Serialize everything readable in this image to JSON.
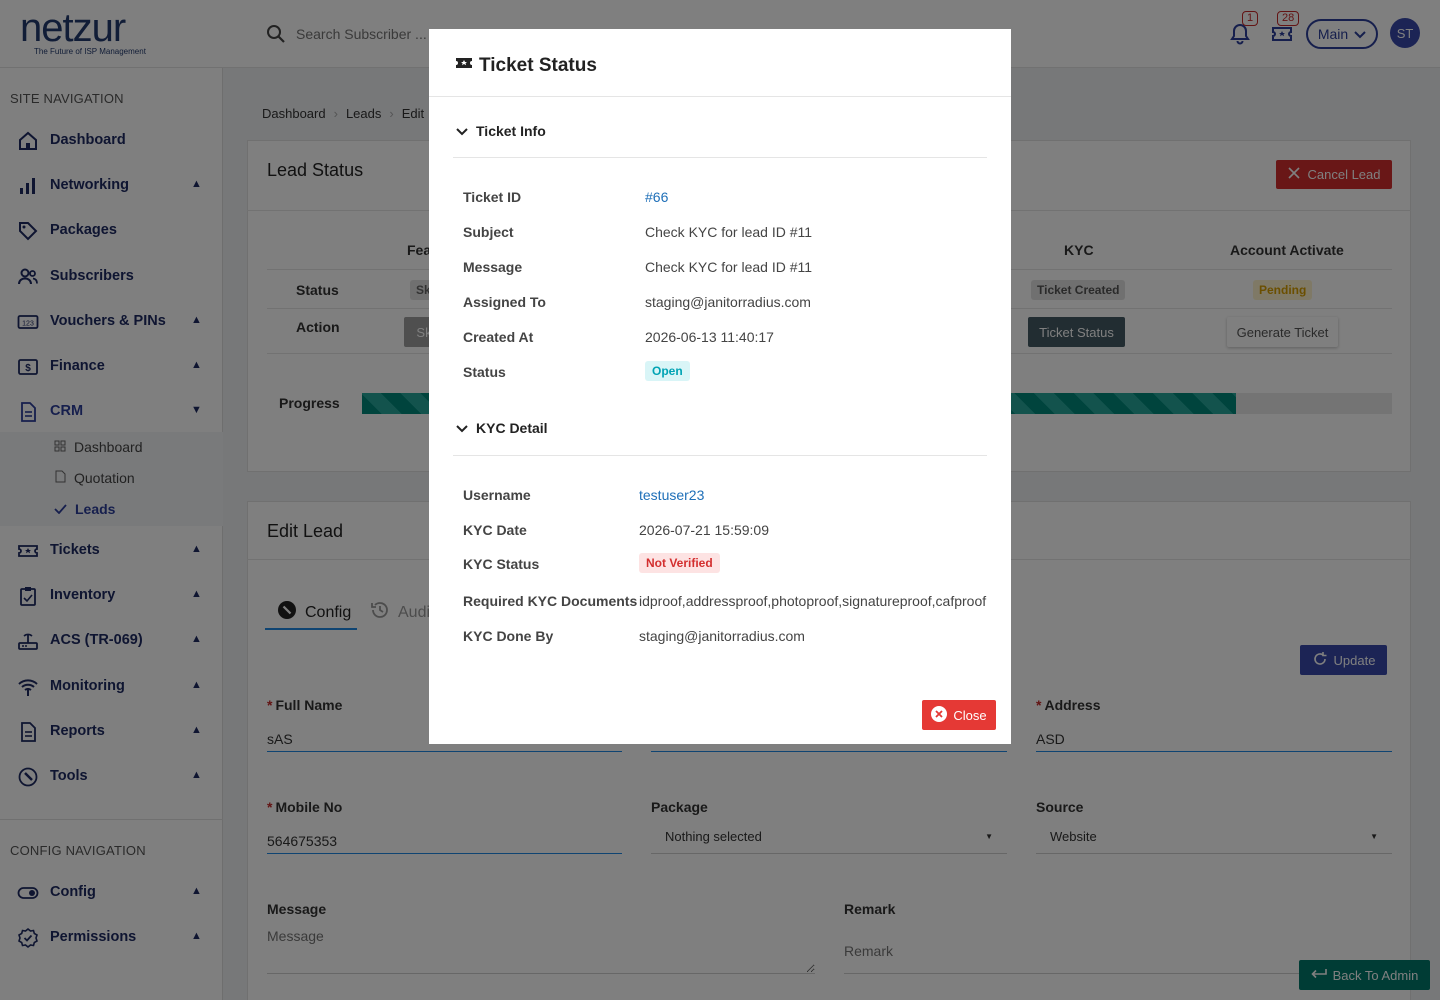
{
  "header": {
    "logo_text": "netzur",
    "logo_tagline": "The Future of ISP Management",
    "search_placeholder": "Search Subscriber ...",
    "notifications_count": "1",
    "tickets_count": "28",
    "workspace_label": "Main",
    "avatar_initials": "ST"
  },
  "sidebar": {
    "site_nav_title": "SITE NAVIGATION",
    "items": [
      {
        "label": "Dashboard"
      },
      {
        "label": "Networking"
      },
      {
        "label": "Packages"
      },
      {
        "label": "Subscribers"
      },
      {
        "label": "Vouchers & PINs"
      },
      {
        "label": "Finance"
      },
      {
        "label": "CRM"
      },
      {
        "label": "Tickets"
      },
      {
        "label": "Inventory"
      },
      {
        "label": "ACS (TR-069)"
      },
      {
        "label": "Monitoring"
      },
      {
        "label": "Reports"
      },
      {
        "label": "Tools"
      }
    ],
    "crm_sub": [
      {
        "label": "Dashboard"
      },
      {
        "label": "Quotation"
      },
      {
        "label": "Leads"
      }
    ],
    "config_nav_title": "CONFIG NAVIGATION",
    "config_items": [
      {
        "label": "Config"
      },
      {
        "label": "Permissions"
      }
    ]
  },
  "breadcrumb": [
    "Dashboard",
    "Leads",
    "Edit"
  ],
  "lead_status": {
    "title": "Lead Status",
    "cancel_label": "Cancel Lead",
    "col_feasibility": "Fea",
    "col_kyc": "KYC",
    "col_account": "Account Activate",
    "row_status": "Status",
    "row_action": "Action",
    "feas_status": "Sk",
    "feas_action": "Sk",
    "kyc_status": "Ticket Created",
    "kyc_action": "Ticket Status",
    "account_status": "Pending",
    "account_action": "Generate Ticket",
    "progress_label": "Progress",
    "progress_fraction": 0.849
  },
  "edit_lead": {
    "title": "Edit Lead",
    "tab_config": "Config",
    "tab_audit": "Audi",
    "update_label": "Update",
    "full_name_label": "Full Name",
    "full_name_value": "sAS",
    "address_label": "Address",
    "address_value": "ASD",
    "mobile_label": "Mobile No",
    "mobile_value": "564675353",
    "package_label": "Package",
    "package_value": "Nothing selected",
    "source_label": "Source",
    "source_value": "Website",
    "message_label": "Message",
    "message_placeholder": "Message",
    "remark_label": "Remark",
    "remark_placeholder": "Remark",
    "back_label": "Back To Admin"
  },
  "modal": {
    "title": "Ticket Status",
    "ticket_info_heading": "Ticket Info",
    "ticket_fields": [
      {
        "key": "Ticket ID",
        "value": "#66"
      },
      {
        "key": "Subject",
        "value": "Check KYC for lead ID #11"
      },
      {
        "key": "Message",
        "value": "Check KYC for lead ID #11"
      },
      {
        "key": "Assigned To",
        "value": "staging@janitorradius.com"
      },
      {
        "key": "Created At",
        "value": "2026-06-13 11:40:17"
      },
      {
        "key": "Status",
        "value": "Open"
      }
    ],
    "kyc_heading": "KYC Detail",
    "kyc_fields": [
      {
        "key": "Username",
        "value": "testuser23"
      },
      {
        "key": "KYC Date",
        "value": "2026-07-21 15:59:09"
      },
      {
        "key": "KYC Status",
        "value": "Not Verified"
      },
      {
        "key": "Required KYC Documents",
        "value": "idproof,addressproof,photoproof,signatureproof,cafproof"
      },
      {
        "key": "KYC Done By",
        "value": "staging@janitorradius.com"
      }
    ],
    "close_label": "Close"
  },
  "colors": {
    "brand_navy": "#1e2b63",
    "accent_blue": "#3949ab",
    "danger": "#d32f2f",
    "progress": "#00897b"
  }
}
